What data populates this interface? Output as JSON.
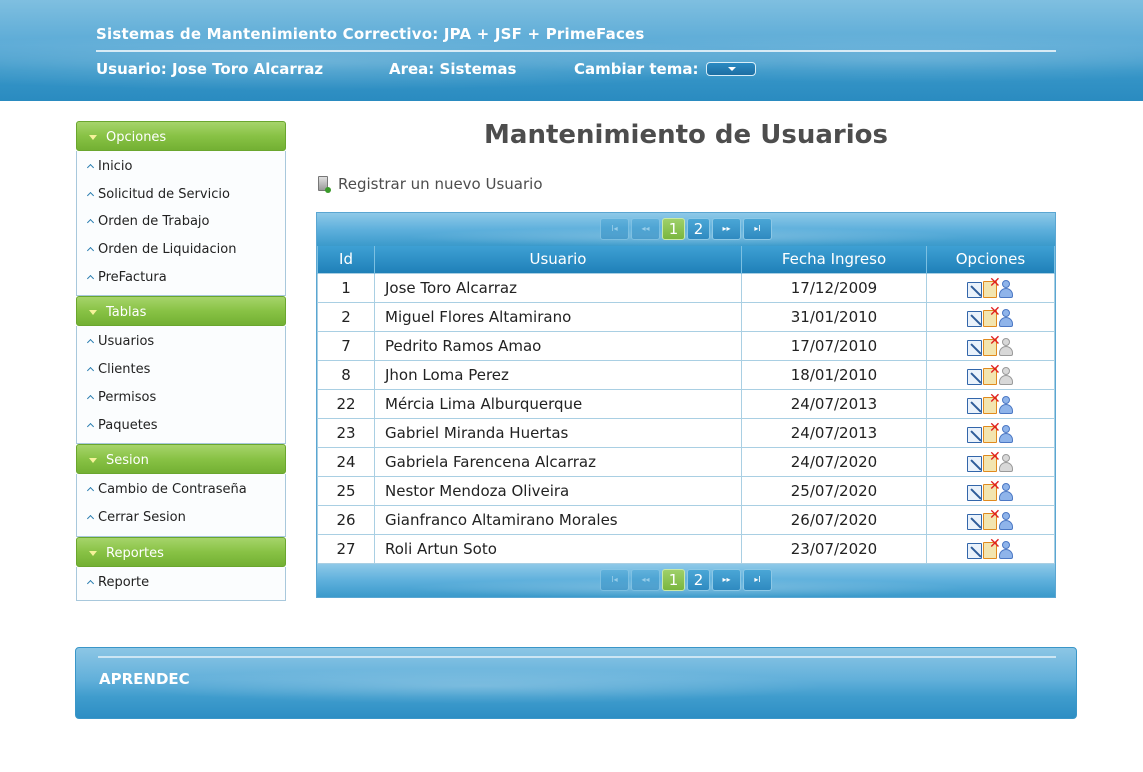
{
  "header": {
    "title": "Sistemas de Mantenimiento Correctivo: JPA + JSF + PrimeFaces",
    "user_label": "Usuario: Jose Toro Alcarraz",
    "area_label": "Area: Sistemas",
    "theme_label": "Cambiar tema:"
  },
  "sidebar": {
    "panels": [
      {
        "title": "Opciones",
        "items": [
          "Inicio",
          "Solicitud de Servicio",
          "Orden de Trabajo",
          "Orden de Liquidacion",
          "PreFactura"
        ]
      },
      {
        "title": "Tablas",
        "items": [
          "Usuarios",
          "Clientes",
          "Permisos",
          "Paquetes"
        ]
      },
      {
        "title": "Sesion",
        "items": [
          "Cambio de Contraseña",
          "Cerrar Sesion"
        ]
      },
      {
        "title": "Reportes",
        "items": [
          "Reporte"
        ]
      }
    ]
  },
  "main": {
    "title": "Mantenimiento de Usuarios",
    "register_link": "Registrar un nuevo Usuario",
    "paginator": {
      "first": "I◂",
      "prev": "◂◂",
      "next": "▸▸",
      "last": "▸I",
      "pages": [
        "1",
        "2"
      ]
    },
    "table": {
      "headers": [
        "Id",
        "Usuario",
        "Fecha Ingreso",
        "Opciones"
      ],
      "rows": [
        {
          "id": "1",
          "usuario": "Jose Toro Alcarraz",
          "fecha": "17/12/2009",
          "active": true
        },
        {
          "id": "2",
          "usuario": "Miguel Flores Altamirano",
          "fecha": "31/01/2010",
          "active": true
        },
        {
          "id": "7",
          "usuario": "Pedrito Ramos Amao",
          "fecha": "17/07/2010",
          "active": false
        },
        {
          "id": "8",
          "usuario": "Jhon Loma Perez",
          "fecha": "18/01/2010",
          "active": false
        },
        {
          "id": "22",
          "usuario": "Mércia Lima Alburquerque",
          "fecha": "24/07/2013",
          "active": true
        },
        {
          "id": "23",
          "usuario": "Gabriel Miranda Huertas",
          "fecha": "24/07/2013",
          "active": true
        },
        {
          "id": "24",
          "usuario": "Gabriela Farencena Alcarraz",
          "fecha": "24/07/2020",
          "active": false
        },
        {
          "id": "25",
          "usuario": "Nestor Mendoza Oliveira",
          "fecha": "25/07/2020",
          "active": true
        },
        {
          "id": "26",
          "usuario": "Gianfranco Altamirano Morales",
          "fecha": "26/07/2020",
          "active": true
        },
        {
          "id": "27",
          "usuario": "Roli Artun Soto",
          "fecha": "23/07/2020",
          "active": true
        }
      ]
    }
  },
  "footer": {
    "text": "APRENDEC"
  },
  "icons": {
    "edit": "edit-icon",
    "delete": "delete-icon",
    "user_active": "user-active-icon",
    "user_inactive": "user-inactive-icon",
    "register": "new-document-icon"
  },
  "colors": {
    "header_blue": "#3796c8",
    "panel_green": "#88c245",
    "table_header": "#1f80b8",
    "active_page": "#79b63e"
  }
}
